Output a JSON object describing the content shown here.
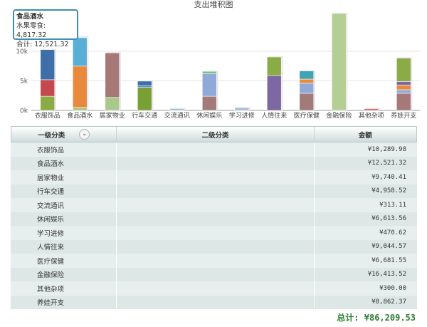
{
  "chart_data": {
    "type": "bar",
    "stacked": true,
    "title": "支出堆积图",
    "categories": [
      "衣服饰品",
      "食品酒水",
      "居家物业",
      "行车交通",
      "交流通讯",
      "休闲娱乐",
      "学习进修",
      "人情往来",
      "医疗保健",
      "金融保险",
      "其他杂项",
      "养娃开支"
    ],
    "totals": [
      10289.98,
      12521.32,
      9740.41,
      4958.52,
      313.11,
      6613.56,
      470.62,
      9044.57,
      6681.55,
      16413.52,
      300.0,
      8862.37
    ],
    "segments": [
      [
        {
          "v": 2400,
          "c": "#8bab47"
        },
        {
          "v": 2800,
          "c": "#c24a4e"
        },
        {
          "v": 5090,
          "c": "#3f6fa8"
        }
      ],
      [
        {
          "v": 500,
          "c": "#a8c879"
        },
        {
          "v": 7000,
          "c": "#e8893e"
        },
        {
          "v": 4817.32,
          "c": "#58aed4"
        },
        {
          "v": 204,
          "c": "#cfe3ee"
        }
      ],
      [
        {
          "v": 2200,
          "c": "#a8c98a"
        },
        {
          "v": 7540,
          "c": "#a77878"
        }
      ],
      [
        {
          "v": 3900,
          "c": "#78a035"
        },
        {
          "v": 300,
          "c": "#5f88c0"
        },
        {
          "v": 759,
          "c": "#3d6fa8"
        }
      ],
      [
        {
          "v": 313.11,
          "c": "#a9bdd9"
        }
      ],
      [
        {
          "v": 2400,
          "c": "#a37a7a"
        },
        {
          "v": 3800,
          "c": "#8fa9d9"
        },
        {
          "v": 414,
          "c": "#7dbb8e"
        }
      ],
      [
        {
          "v": 470.62,
          "c": "#a9bdd9"
        }
      ],
      [
        {
          "v": 5900,
          "c": "#7d68a3"
        },
        {
          "v": 3145,
          "c": "#8bab47"
        }
      ],
      [
        {
          "v": 2900,
          "c": "#a27a78"
        },
        {
          "v": 1700,
          "c": "#8fa9d9"
        },
        {
          "v": 700,
          "c": "#e8893e"
        },
        {
          "v": 1382,
          "c": "#3fa4b5"
        }
      ],
      [
        {
          "v": 16413.52,
          "c": "#b3cf93"
        }
      ],
      [
        {
          "v": 300,
          "c": "#c96e6e"
        }
      ],
      [
        {
          "v": 2900,
          "c": "#a77878"
        },
        {
          "v": 600,
          "c": "#8fa9d9"
        },
        {
          "v": 800,
          "c": "#e8893e"
        },
        {
          "v": 600,
          "c": "#7d68a3"
        },
        {
          "v": 3962,
          "c": "#8bab47"
        }
      ]
    ],
    "y_ticks": [
      "0k",
      "5k",
      "10k"
    ],
    "ylim": [
      0,
      17000
    ]
  },
  "tooltip": {
    "title": "食品酒水",
    "line1": "水果零食: 4,817.32",
    "line2": "合计: 12,521.32"
  },
  "table": {
    "headers": [
      "一级分类",
      "二级分类",
      "金额"
    ],
    "rows": [
      {
        "category": "衣服饰品",
        "amount": "¥10,289.98"
      },
      {
        "category": "食品酒水",
        "amount": "¥12,521.32"
      },
      {
        "category": "居家物业",
        "amount": "¥9,740.41"
      },
      {
        "category": "行车交通",
        "amount": "¥4,958.52"
      },
      {
        "category": "交流通讯",
        "amount": "¥313.11"
      },
      {
        "category": "休闲娱乐",
        "amount": "¥6,613.56"
      },
      {
        "category": "学习进修",
        "amount": "¥470.62"
      },
      {
        "category": "人情往来",
        "amount": "¥9,044.57"
      },
      {
        "category": "医疗保健",
        "amount": "¥6,681.55"
      },
      {
        "category": "金融保险",
        "amount": "¥16,413.52"
      },
      {
        "category": "其他杂项",
        "amount": "¥300.00"
      },
      {
        "category": "养娃开支",
        "amount": "¥8,862.37"
      }
    ]
  },
  "total_label": "总计: ¥86,209.53",
  "icons": {
    "sort": "chevron-double-down-icon"
  }
}
